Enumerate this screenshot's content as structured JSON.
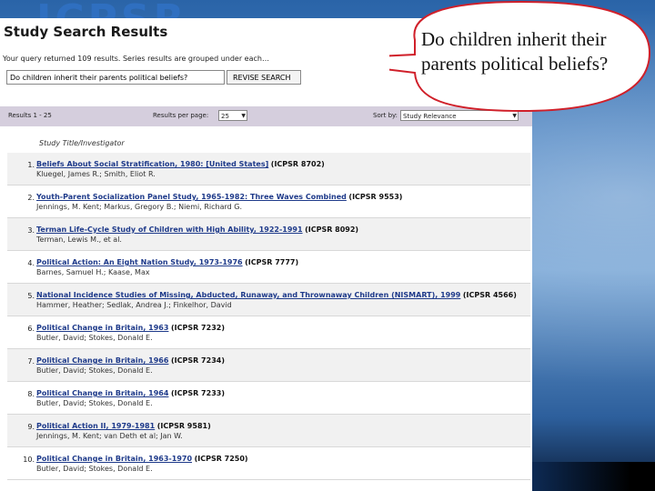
{
  "page": {
    "title": "Study Search Results",
    "summary": "Your query returned 109 results. Series results are grouped under each…",
    "query_value": "Do children inherit their parents political beliefs?",
    "revise_label": "REVISE SEARCH"
  },
  "filters": {
    "results_range": "Results 1 - 25",
    "per_page_label": "Results per page:",
    "per_page_value": "25",
    "sort_label": "Sort by:",
    "sort_value": "Study Relevance"
  },
  "column_header": "Study Title/Investigator",
  "results": [
    {
      "num": "1.",
      "title": "Beliefs About Social Stratification, 1980: [United States]",
      "code": "(ICPSR 8702)",
      "authors": "Kluegel, James R.; Smith, Eliot R."
    },
    {
      "num": "2.",
      "title": "Youth-Parent Socialization Panel Study, 1965-1982: Three Waves Combined",
      "code": "(ICPSR 9553)",
      "authors": "Jennings, M. Kent; Markus, Gregory B.; Niemi, Richard G."
    },
    {
      "num": "3.",
      "title": "Terman Life-Cycle Study of Children with High Ability, 1922-1991",
      "code": "(ICPSR 8092)",
      "authors": "Terman, Lewis M., et al."
    },
    {
      "num": "4.",
      "title": "Political Action: An Eight Nation Study, 1973-1976",
      "code": "(ICPSR 7777)",
      "authors": "Barnes, Samuel H.; Kaase, Max"
    },
    {
      "num": "5.",
      "title": "National Incidence Studies of Missing, Abducted, Runaway, and Thrownaway Children (NISMART), 1999",
      "code": "(ICPSR 4566)",
      "authors": "Hammer, Heather; Sedlak, Andrea J.; Finkelhor, David"
    },
    {
      "num": "6.",
      "title": "Political Change in Britain, 1963",
      "code": "(ICPSR 7232)",
      "authors": "Butler, David; Stokes, Donald E."
    },
    {
      "num": "7.",
      "title": "Political Change in Britain, 1966",
      "code": "(ICPSR 7234)",
      "authors": "Butler, David; Stokes, Donald E."
    },
    {
      "num": "8.",
      "title": "Political Change in Britain, 1964",
      "code": "(ICPSR 7233)",
      "authors": "Butler, David; Stokes, Donald E."
    },
    {
      "num": "9.",
      "title": "Political Action II, 1979-1981",
      "code": "(ICPSR 9581)",
      "authors": "Jennings, M. Kent; van Deth et al; Jan W."
    },
    {
      "num": "10.",
      "title": "Political Change in Britain, 1963-1970",
      "code": "(ICPSR 7250)",
      "authors": "Butler, David; Stokes, Donald E."
    }
  ],
  "callout": {
    "text": "Do children inherit their parents political beliefs?",
    "fill": "#ffffff",
    "stroke": "#d0202a"
  }
}
